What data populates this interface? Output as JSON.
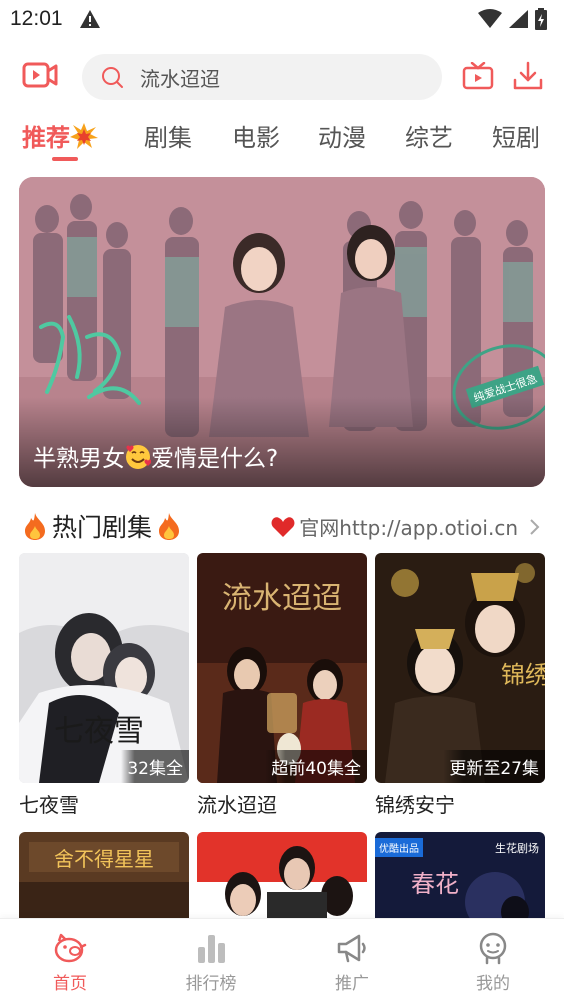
{
  "status_bar": {
    "time": "12:01",
    "icons": [
      "warning-icon",
      "wifi-icon",
      "signal-icon",
      "battery-icon"
    ]
  },
  "header": {
    "search": {
      "value": "流水迢迢",
      "icon": "search-icon"
    },
    "left_icon": "video-icon",
    "right_icons": [
      "tv-icon",
      "download-icon"
    ]
  },
  "tabs": [
    {
      "label": "推荐",
      "active": true
    },
    {
      "label": "剧集",
      "active": false
    },
    {
      "label": "电影",
      "active": false
    },
    {
      "label": "动漫",
      "active": false
    },
    {
      "label": "综艺",
      "active": false
    },
    {
      "label": "短剧",
      "active": false
    }
  ],
  "banner": {
    "caption_before": "半熟男女",
    "caption_after": "爱情是什么?",
    "stamp_text": "纯爱战士很急"
  },
  "section": {
    "title": "热门剧集",
    "link_text": "官网http://app.otioi.cn"
  },
  "cards": [
    {
      "title": "七夜雪",
      "badge": "32集全",
      "poster_text": "七夜雪"
    },
    {
      "title": "流水迢迢",
      "badge": "超前40集全",
      "poster_text": "流水迢迢"
    },
    {
      "title": "锦绣安宁",
      "badge": "更新至27集",
      "poster_text": "锦绣"
    }
  ],
  "partial_cards": [
    {
      "poster_text": "舍不得星星"
    },
    {
      "poster_text": ""
    },
    {
      "poster_text": "春花",
      "corner_badge": "优酷出品",
      "brand": "生花剧场"
    }
  ],
  "bottom_nav": [
    {
      "label": "首页",
      "icon": "pig-home-icon",
      "active": true
    },
    {
      "label": "排行榜",
      "icon": "bar-chart-icon",
      "active": false
    },
    {
      "label": "推广",
      "icon": "megaphone-icon",
      "active": false
    },
    {
      "label": "我的",
      "icon": "profile-icon",
      "active": false
    }
  ],
  "colors": {
    "accent": "#f05a5a",
    "banner_bg": "#c48c95"
  }
}
